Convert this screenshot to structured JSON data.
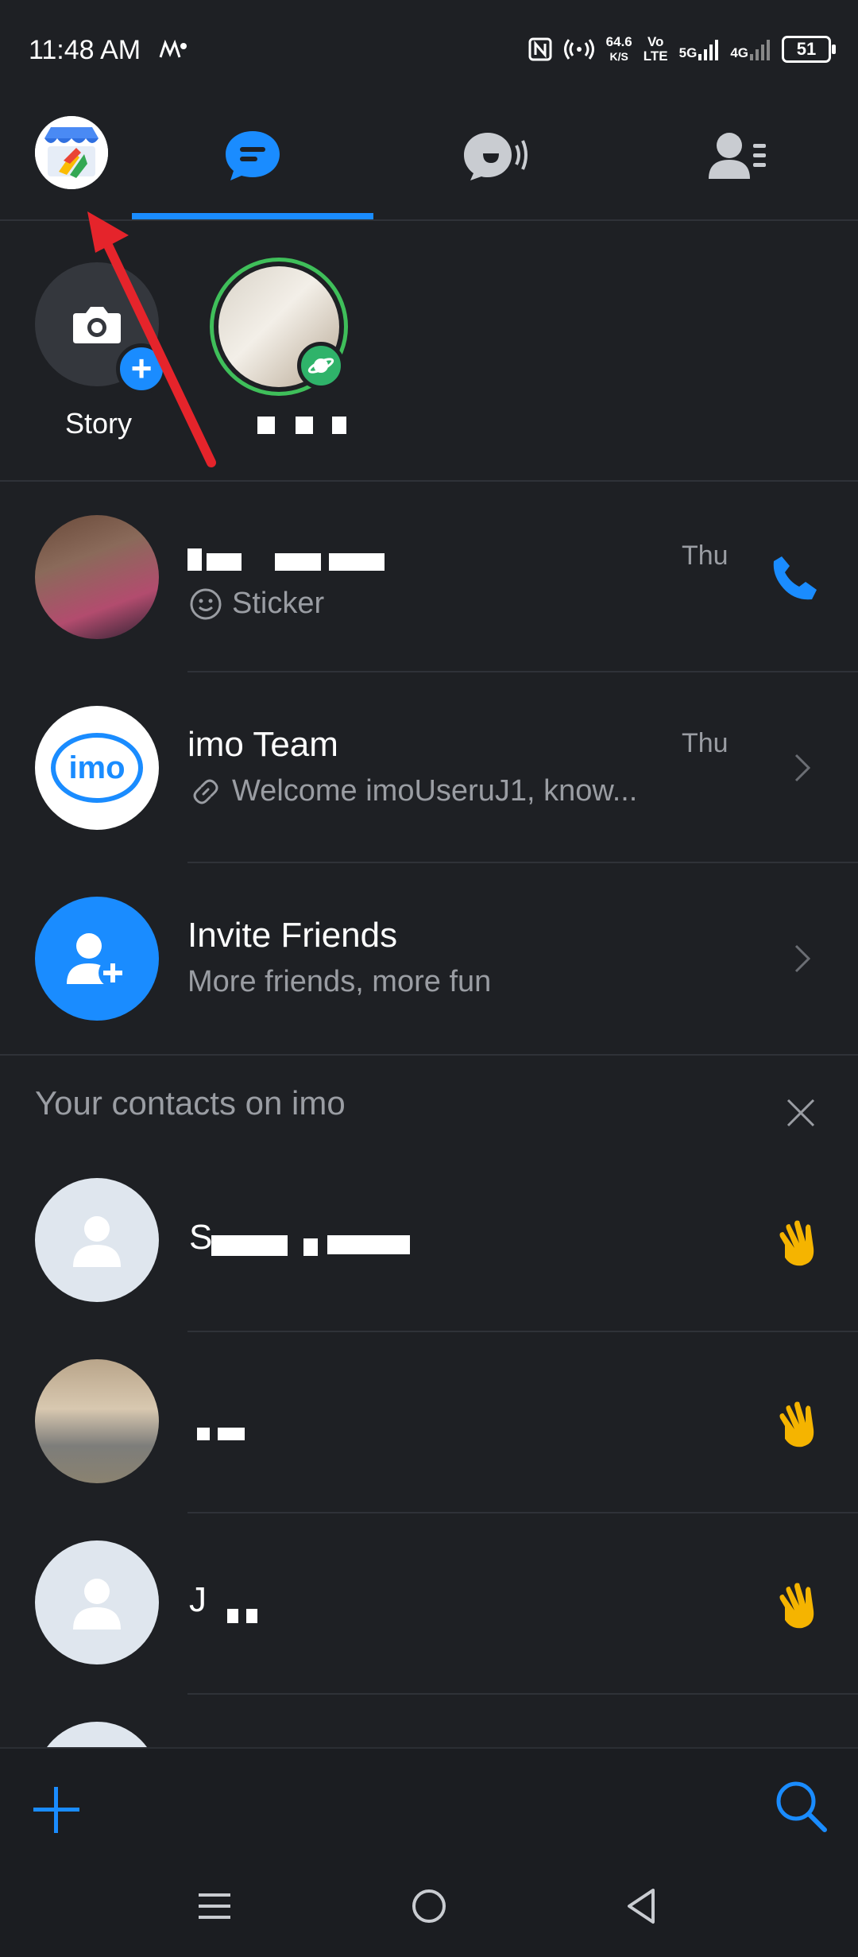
{
  "status_bar": {
    "time": "11:48 AM",
    "speed_value": "64.6",
    "speed_unit": "K/S",
    "volte_top": "Vo",
    "volte_bottom": "LTE",
    "net1": "5G",
    "net2": "4G",
    "battery": "51"
  },
  "stories": {
    "add_label": "Story"
  },
  "chats": [
    {
      "title": "",
      "subtitle": "Sticker",
      "time": "Thu"
    },
    {
      "title": "imo Team",
      "subtitle": "Welcome imoUseruJ1, know...",
      "time": "Thu",
      "avatar_text": "imo"
    },
    {
      "title": "Invite Friends",
      "subtitle": "More friends, more fun"
    }
  ],
  "contacts": {
    "header": "Your contacts on imo",
    "items": [
      {
        "name_prefix": "S"
      },
      {
        "name_prefix": ""
      },
      {
        "name_prefix": "J"
      }
    ]
  },
  "colors": {
    "accent": "#1a8cff",
    "background": "#1e2024",
    "story_ring": "#3fbf5a",
    "wave": "#f5b400",
    "annotation_arrow": "#e5242b"
  }
}
